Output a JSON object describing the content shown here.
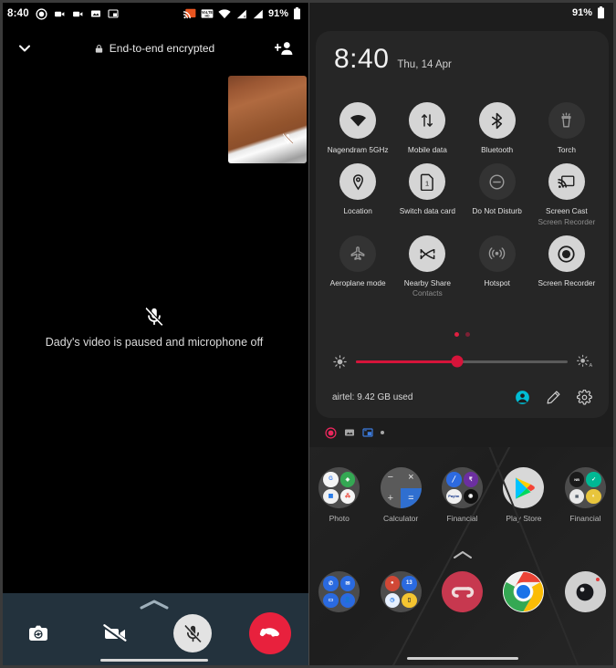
{
  "left_panel": {
    "status_bar": {
      "time": "8:40",
      "battery_pct": "91%",
      "left_icons": [
        "record-dot-icon",
        "video-camera-icon",
        "video-camera-icon",
        "image-icon",
        "picture-in-picture-icon"
      ],
      "right_icons": [
        "screen-cast-icon",
        "volte-icon",
        "wifi-icon",
        "signal-1-icon",
        "signal-2-icon",
        "battery-icon"
      ]
    },
    "header": {
      "collapse_icon": "chevron-down-icon",
      "lock_icon": "lock-icon",
      "title": "End-to-end encrypted",
      "add_person_icon": "add-person-icon"
    },
    "self_view": {
      "mic_icon": "mic-off-icon"
    },
    "call_status": {
      "icon": "mic-off-icon",
      "text": "Dady's video is paused and microphone off"
    },
    "controls": {
      "expand_icon": "chevron-up-icon",
      "buttons": [
        {
          "name": "flip-camera-button",
          "icon": "flip-camera-icon",
          "state": "inactive"
        },
        {
          "name": "video-off-button",
          "icon": "video-off-icon",
          "state": "inactive"
        },
        {
          "name": "mute-button",
          "icon": "mic-off-icon",
          "state": "active"
        },
        {
          "name": "end-call-button",
          "icon": "end-call-icon",
          "state": "end"
        }
      ]
    }
  },
  "right_panel": {
    "status_bar": {
      "battery_pct": "91%",
      "battery_icon": "battery-icon"
    },
    "clock": {
      "time": "8:40",
      "date": "Thu, 14 Apr"
    },
    "tiles": [
      [
        {
          "label": "Nagendram 5GHz",
          "sub": "",
          "icon": "wifi-icon",
          "state": "on"
        },
        {
          "label": "Mobile data",
          "sub": "",
          "icon": "mobile-data-icon",
          "state": "on"
        },
        {
          "label": "Bluetooth",
          "sub": "",
          "icon": "bluetooth-icon",
          "state": "on"
        },
        {
          "label": "Torch",
          "sub": "",
          "icon": "torch-icon",
          "state": "off"
        }
      ],
      [
        {
          "label": "Location",
          "sub": "",
          "icon": "location-pin-icon",
          "state": "on"
        },
        {
          "label": "Switch data card",
          "sub": "",
          "icon": "sim-card-icon",
          "state": "on"
        },
        {
          "label": "Do Not Disturb",
          "sub": "",
          "icon": "do-not-disturb-icon",
          "state": "off"
        },
        {
          "label": "Screen Cast",
          "sub": "Screen Recorder",
          "icon": "screen-cast-icon",
          "state": "on"
        }
      ],
      [
        {
          "label": "Aeroplane mode",
          "sub": "",
          "icon": "airplane-icon",
          "state": "off"
        },
        {
          "label": "Nearby Share",
          "sub": "Contacts",
          "icon": "nearby-share-icon",
          "state": "on"
        },
        {
          "label": "Hotspot",
          "sub": "",
          "icon": "hotspot-icon",
          "state": "off"
        },
        {
          "label": "Screen Recorder",
          "sub": "",
          "icon": "screen-recorder-icon",
          "state": "on"
        }
      ]
    ],
    "page_dots": {
      "count": 2,
      "active_index": 0
    },
    "brightness": {
      "low_icon": "brightness-low-icon",
      "auto_icon": "brightness-auto-icon",
      "value_pct": 48,
      "fill_color": "#d6143a"
    },
    "footer": {
      "data_usage": "airtel: 9.42 GB used",
      "icons": [
        "user-avatar-icon",
        "edit-pencil-icon",
        "settings-gear-icon"
      ],
      "avatar_color": "#00bcd4"
    },
    "notifications": {
      "icons": [
        "record-dot-icon",
        "image-icon",
        "picture-in-picture-icon"
      ],
      "overflow_dot": true
    },
    "home_screen": {
      "row1": [
        {
          "label": "Photo",
          "icon": "photo-folder-icon"
        },
        {
          "label": "Calculator",
          "icon": "calculator-icon"
        },
        {
          "label": "Financial",
          "icon": "financial-folder-icon"
        },
        {
          "label": "Play Store",
          "icon": "play-store-icon"
        },
        {
          "label": "Financial",
          "icon": "financial-folder-2-icon"
        }
      ],
      "expand_icon": "chevron-up-icon",
      "dock": [
        {
          "label": "",
          "icon": "communication-folder-icon"
        },
        {
          "label": "",
          "icon": "tools-folder-icon",
          "badge": "13"
        },
        {
          "label": "",
          "icon": "autodesk-app-icon"
        },
        {
          "label": "",
          "icon": "chrome-icon"
        },
        {
          "label": "",
          "icon": "camera-icon"
        }
      ]
    }
  },
  "annotation": {
    "arrow": {
      "name": "red-arrow-pointer",
      "color": "#ed1c24",
      "points_to": "Screen Recorder"
    }
  }
}
